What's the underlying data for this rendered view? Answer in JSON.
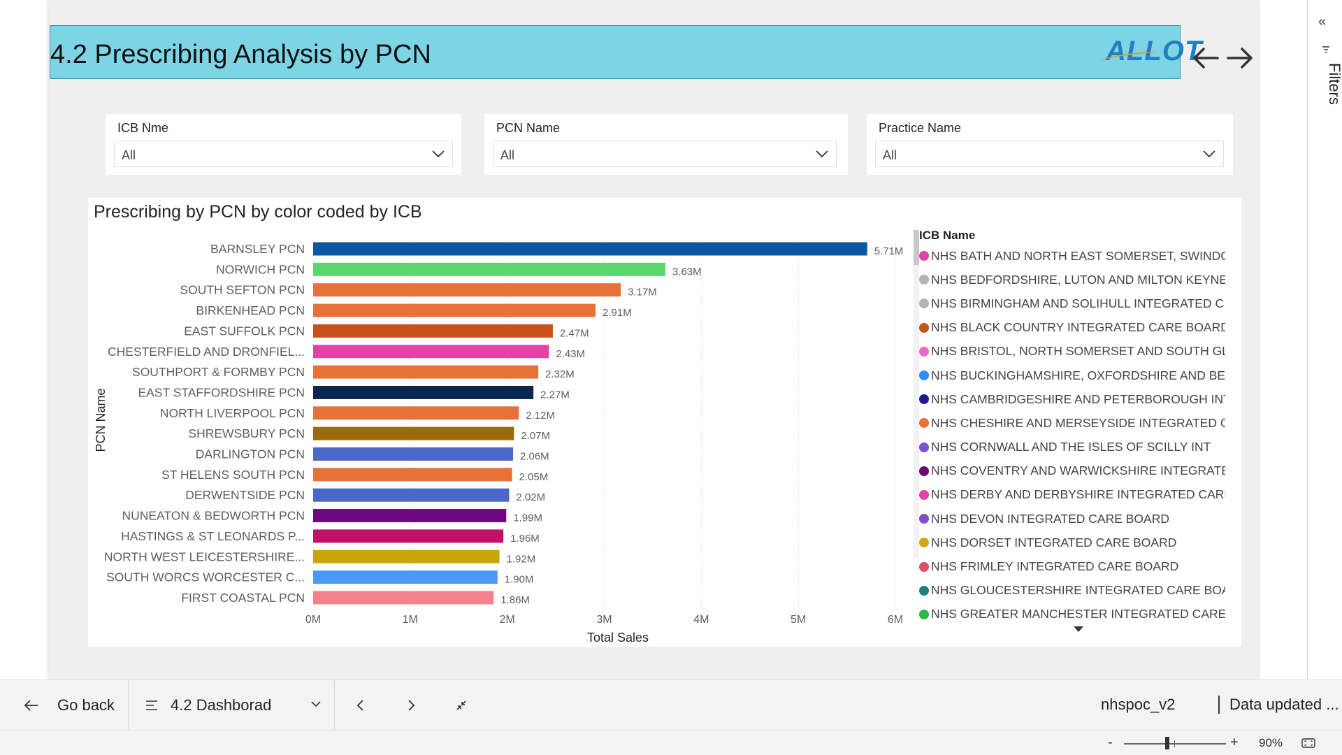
{
  "page_title": "4.2 Prescribing Analysis by PCN",
  "brand": "ALLOT",
  "slicers": [
    {
      "label": "ICB Nme",
      "value": "All"
    },
    {
      "label": "PCN Name",
      "value": "All"
    },
    {
      "label": "Practice Name",
      "value": "All"
    }
  ],
  "chart_title": "Prescribing by PCN by color coded by ICB",
  "legend": {
    "title": "ICB Name",
    "items": [
      {
        "label": "NHS BATH AND NORTH EAST SOMERSET, SWINDO",
        "color": "#e044a7"
      },
      {
        "label": "NHS BEDFORDSHIRE, LUTON AND MILTON KEYNE",
        "color": "#b3b3b3"
      },
      {
        "label": "NHS BIRMINGHAM AND SOLIHULL INTEGRATED C",
        "color": "#b3b3b3"
      },
      {
        "label": "NHS BLACK COUNTRY INTEGRATED CARE BOARD",
        "color": "#c0561a"
      },
      {
        "label": "NHS BRISTOL, NORTH SOMERSET AND SOUTH GL",
        "color": "#e86ac8"
      },
      {
        "label": "NHS BUCKINGHAMSHIRE, OXFORDSHIRE AND BER",
        "color": "#2b8ef5"
      },
      {
        "label": "NHS CAMBRIDGESHIRE AND PETERBOROUGH INTE",
        "color": "#1c1c8f"
      },
      {
        "label": "NHS CHESHIRE AND MERSEYSIDE INTEGRATED C",
        "color": "#e8713a"
      },
      {
        "label": "NHS CORNWALL AND THE ISLES OF SCILLY INT",
        "color": "#7b52c9"
      },
      {
        "label": "NHS COVENTRY AND WARWICKSHIRE INTEGRATED",
        "color": "#6b0a6b"
      },
      {
        "label": "NHS DERBY AND DERBYSHIRE INTEGRATED CARE",
        "color": "#e044a7"
      },
      {
        "label": "NHS DEVON INTEGRATED CARE BOARD",
        "color": "#7b52c9"
      },
      {
        "label": "NHS DORSET INTEGRATED CARE BOARD",
        "color": "#d4a814"
      },
      {
        "label": "NHS FRIMLEY INTEGRATED CARE BOARD",
        "color": "#e0506a"
      },
      {
        "label": "NHS GLOUCESTERSHIRE INTEGRATED CARE BOAR",
        "color": "#1d7f7f"
      },
      {
        "label": "NHS GREATER MANCHESTER INTEGRATED CARE B",
        "color": "#2db84a"
      }
    ]
  },
  "chart_data": {
    "type": "bar",
    "orientation": "horizontal",
    "title": "Prescribing by PCN by color coded by ICB",
    "xlabel": "Total Sales",
    "ylabel": "PCN Name",
    "xlim": [
      0,
      6000000
    ],
    "x_ticks": [
      "0M",
      "1M",
      "2M",
      "3M",
      "4M",
      "5M",
      "6M"
    ],
    "grid": true,
    "legend_placement": "right",
    "categories": [
      "BARNSLEY PCN",
      "NORWICH PCN",
      "SOUTH SEFTON PCN",
      "BIRKENHEAD PCN",
      "EAST SUFFOLK PCN",
      "CHESTERFIELD AND DRONFIEL...",
      "SOUTHPORT & FORMBY PCN",
      "EAST STAFFORDSHIRE PCN",
      "NORTH LIVERPOOL PCN",
      "SHREWSBURY PCN",
      "DARLINGTON PCN",
      "ST HELENS SOUTH PCN",
      "DERWENTSIDE PCN",
      "NUNEATON & BEDWORTH PCN",
      "HASTINGS & ST LEONARDS P...",
      "NORTH WEST LEICESTERSHIRE...",
      "SOUTH WORCS WORCESTER C...",
      "FIRST COASTAL PCN"
    ],
    "values": [
      5710000,
      3630000,
      3170000,
      2910000,
      2470000,
      2430000,
      2320000,
      2270000,
      2120000,
      2070000,
      2060000,
      2050000,
      2020000,
      1990000,
      1960000,
      1920000,
      1900000,
      1860000
    ],
    "data_labels": [
      "5.71M",
      "3.63M",
      "3.17M",
      "2.91M",
      "2.47M",
      "2.43M",
      "2.32M",
      "2.27M",
      "2.12M",
      "2.07M",
      "2.06M",
      "2.05M",
      "2.02M",
      "1.99M",
      "1.96M",
      "1.92M",
      "1.90M",
      "1.86M"
    ],
    "bar_colors": [
      "#0b57a4",
      "#5cd66c",
      "#e8713a",
      "#e8713a",
      "#c9521a",
      "#e044a7",
      "#e8713a",
      "#0a2550",
      "#e8713a",
      "#9a6b0a",
      "#4a68c9",
      "#e8713a",
      "#4a68c9",
      "#6b0a7b",
      "#c0106a",
      "#c9a50a",
      "#4a9af5",
      "#f5818a"
    ]
  },
  "bottom_bar": {
    "go_back": "Go back",
    "page_name": "4.2 Dashborad",
    "dataset": "nhspoc_v2",
    "data_updated": "Data updated ..."
  },
  "right_panel": {
    "filters_label": "Filters"
  },
  "zoom": {
    "level": "90%",
    "minus": "-",
    "plus": "+"
  }
}
